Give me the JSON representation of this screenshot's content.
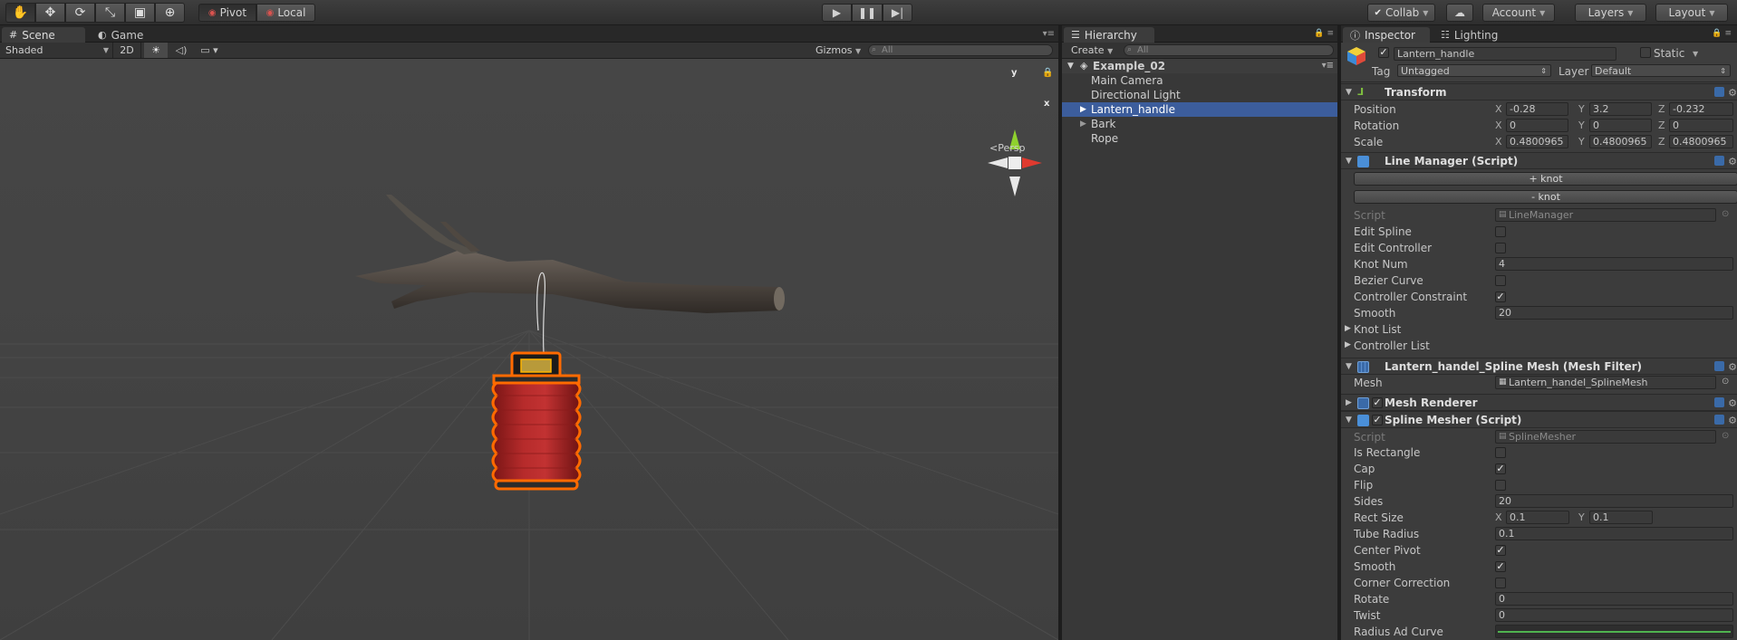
{
  "toolbar": {
    "tools": [
      "hand-tool",
      "move-tool",
      "rotate-tool",
      "scale-tool",
      "rect-tool",
      "transform-tool"
    ],
    "pivot_label": "Pivot",
    "local_label": "Local",
    "collab_label": "Collab",
    "account_label": "Account",
    "layers_label": "Layers",
    "layout_label": "Layout"
  },
  "scene_panel": {
    "tabs": [
      {
        "label": "Scene"
      },
      {
        "label": "Game"
      }
    ],
    "shading_mode": "Shaded",
    "mode_2d": "2D",
    "gizmos_label": "Gizmos",
    "search_placeholder": "All",
    "gizmo": {
      "y": "y",
      "x": "x",
      "persp": "Persp"
    }
  },
  "hierarchy": {
    "tab_label": "Hierarchy",
    "create_label": "Create",
    "search_placeholder": "All",
    "scene_name": "Example_02",
    "items": [
      {
        "label": "Main Camera",
        "expandable": false,
        "selected": false
      },
      {
        "label": "Directional Light",
        "expandable": false,
        "selected": false
      },
      {
        "label": "Lantern_handle",
        "expandable": true,
        "selected": true
      },
      {
        "label": "Bark",
        "expandable": true,
        "selected": false
      },
      {
        "label": "Rope",
        "expandable": false,
        "selected": false
      }
    ]
  },
  "inspector": {
    "tabs": [
      {
        "label": "Inspector"
      },
      {
        "label": "Lighting"
      }
    ],
    "object_name": "Lantern_handle",
    "static_label": "Static",
    "tag_label": "Tag",
    "tag_value": "Untagged",
    "layer_label": "Layer",
    "layer_value": "Default",
    "transform": {
      "title": "Transform",
      "position": {
        "label": "Position",
        "x": "-0.28",
        "y": "3.2",
        "z": "-0.232"
      },
      "rotation": {
        "label": "Rotation",
        "x": "0",
        "y": "0",
        "z": "0"
      },
      "scale": {
        "label": "Scale",
        "x": "0.4800965",
        "y": "0.4800965",
        "z": "0.4800965"
      }
    },
    "line_manager": {
      "title": "Line Manager (Script)",
      "add_knot": "+ knot",
      "remove_knot": "- knot",
      "script_label": "Script",
      "script_value": "LineManager",
      "edit_spline": "Edit Spline",
      "edit_controller": "Edit Controller",
      "knot_num_label": "Knot Num",
      "knot_num": "4",
      "bezier_curve": "Bezier Curve",
      "controller_constraint": "Controller Constraint",
      "smooth_label": "Smooth",
      "smooth_value": "20",
      "knot_list": "Knot List",
      "controller_list": "Controller List"
    },
    "mesh_filter": {
      "title": "Lantern_handel_Spline Mesh (Mesh Filter)",
      "mesh_label": "Mesh",
      "mesh_value": "Lantern_handel_SplineMesh"
    },
    "mesh_renderer": {
      "title": "Mesh Renderer"
    },
    "spline_mesher": {
      "title": "Spline Mesher (Script)",
      "script_label": "Script",
      "script_value": "SplineMesher",
      "is_rectangle": "Is Rectangle",
      "cap": "Cap",
      "flip": "Flip",
      "sides_label": "Sides",
      "sides_value": "20",
      "rect_size_label": "Rect Size",
      "rect_x": "0.1",
      "rect_y": "0.1",
      "tube_radius_label": "Tube Radius",
      "tube_radius": "0.1",
      "center_pivot": "Center Pivot",
      "smooth": "Smooth",
      "corner_correction": "Corner Correction",
      "rotate_label": "Rotate",
      "rotate_value": "0",
      "twist_label": "Twist",
      "twist_value": "0",
      "radius_curve_label": "Radius Ad Curve"
    },
    "axis_labels": {
      "x": "X",
      "y": "Y",
      "z": "Z"
    }
  },
  "colors": {
    "selection": "#3c5d9c",
    "lantern": "#b32a2a",
    "outline": "#ff6a00"
  }
}
